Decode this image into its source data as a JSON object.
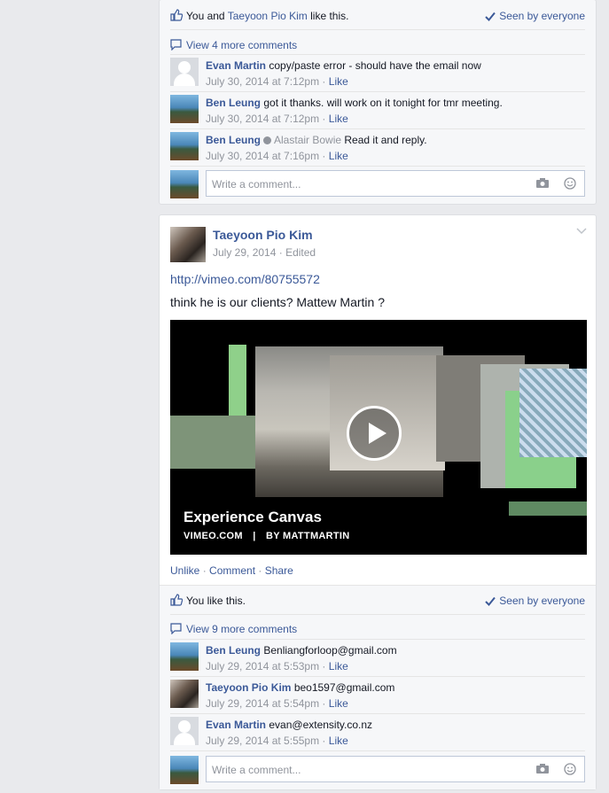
{
  "post1": {
    "likes_text_prefix": "You and ",
    "likes_name": "Taeyoon Pio Kim",
    "likes_text_suffix": " like this.",
    "seen": "Seen by everyone",
    "view_more": "View 4 more comments",
    "comments": [
      {
        "name": "Evan Martin",
        "text": "copy/paste error - should have the email now",
        "time": "July 30, 2014 at 7:12pm",
        "like": "Like",
        "avatar": "gray"
      },
      {
        "name": "Ben Leung",
        "text": "got it thanks. will work on it tonight for tmr meeting.",
        "time": "July 30, 2014 at 7:12pm",
        "like": "Like",
        "avatar": "ben"
      },
      {
        "name": "Ben Leung",
        "tag": "Alastair Bowie",
        "text": "Read it and reply.",
        "time": "July 30, 2014 at 7:16pm",
        "like": "Like",
        "avatar": "ben"
      }
    ],
    "comment_placeholder": "Write a comment..."
  },
  "post2": {
    "author": "Taeyoon Pio Kim",
    "date": "July 29, 2014",
    "edited": "Edited",
    "link": "http://vimeo.com/80755572",
    "message": "think he is our clients? Mattew Martin ?",
    "video": {
      "title": "Experience Canvas",
      "source": "VIMEO.COM",
      "separator": "|",
      "by": "BY MATTMARTIN"
    },
    "actions": {
      "unlike": "Unlike",
      "comment": "Comment",
      "share": "Share",
      "sep": "·"
    },
    "likes_text": "You like this.",
    "seen": "Seen by everyone",
    "view_more": "View 9 more comments",
    "comments": [
      {
        "name": "Ben Leung",
        "text": "Benliangforloop@gmail.com",
        "time": "July 29, 2014 at 5:53pm",
        "like": "Like",
        "avatar": "ben"
      },
      {
        "name": "Taeyoon Pio Kim",
        "text": "beo1597@gmail.com",
        "time": "July 29, 2014 at 5:54pm",
        "like": "Like",
        "avatar": "tae"
      },
      {
        "name": "Evan Martin",
        "text": "evan@extensity.co.nz",
        "time": "July 29, 2014 at 5:55pm",
        "like": "Like",
        "avatar": "gray"
      }
    ],
    "comment_placeholder": "Write a comment..."
  },
  "colors": {
    "link": "#3b5998",
    "muted": "#90949c",
    "background": "#e9eaed"
  }
}
